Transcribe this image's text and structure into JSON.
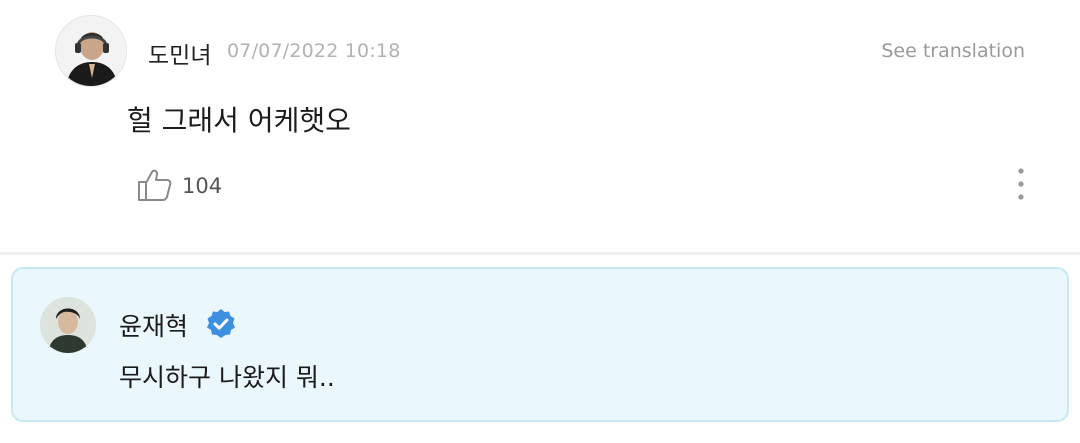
{
  "comment": {
    "author": "도민녀",
    "timestamp": "07/07/2022 10:18",
    "see_translation": "See translation",
    "text": "헐 그래서 어케햇오",
    "like_count": "104"
  },
  "reply": {
    "author": "윤재혁",
    "verified": true,
    "text": "무시하구 나왔지 뭐.."
  },
  "icons": {
    "like": "thumbs-up-icon",
    "more": "more-vertical-icon",
    "verified": "verified-badge-icon"
  },
  "colors": {
    "reply_background": "#eaf7fd",
    "reply_border": "#c6e8f2",
    "verified_blue": "#3d8fe0"
  }
}
